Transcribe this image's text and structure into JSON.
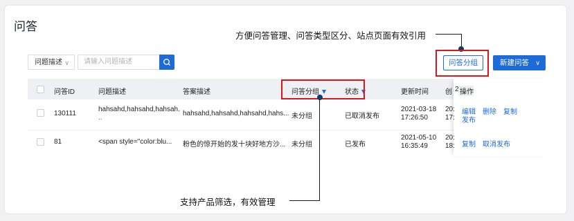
{
  "page": {
    "title": "问答"
  },
  "annotations": {
    "top": "方便问答管理、问答类型区分、站点页面有效引用",
    "bottom": "支持产品筛选，有效管理"
  },
  "toolbar": {
    "select_label": "问题描述",
    "search_placeholder": "请输入问题描述",
    "group_button": "问答分组",
    "new_button": "新建问答"
  },
  "table": {
    "columns": [
      "问答ID",
      "问题描述",
      "答案描述",
      "问答分组",
      "状态",
      "更新时间",
      "创",
      "操作"
    ],
    "rows": [
      {
        "id": "130111",
        "question": "hahsahd,hahsahd,hahsah.",
        "question_more": "..",
        "answer": "hahsahd,hahsahd,hahsahd,hahs...",
        "group": "未分组",
        "status": "已取消发布",
        "updated_date": "2021-03-18",
        "updated_time": "17:26:50",
        "created_a": "20:",
        "created_b": "17:",
        "ops": [
          "编辑",
          "删除",
          "复制",
          "发布"
        ]
      },
      {
        "id": "81",
        "question": "<span style=\"color:blu...",
        "answer": "粉色的惊开始的发十块好地方沙...",
        "group": "未分组",
        "status": "已发布",
        "updated_date": "2021-05-10",
        "updated_time": "16:35:49",
        "created_a": "20:",
        "created_b": "18:",
        "ops": [
          "复制",
          "取消发布"
        ]
      }
    ]
  },
  "colors": {
    "accent": "#1c6bd9",
    "highlight": "#d9161c"
  }
}
